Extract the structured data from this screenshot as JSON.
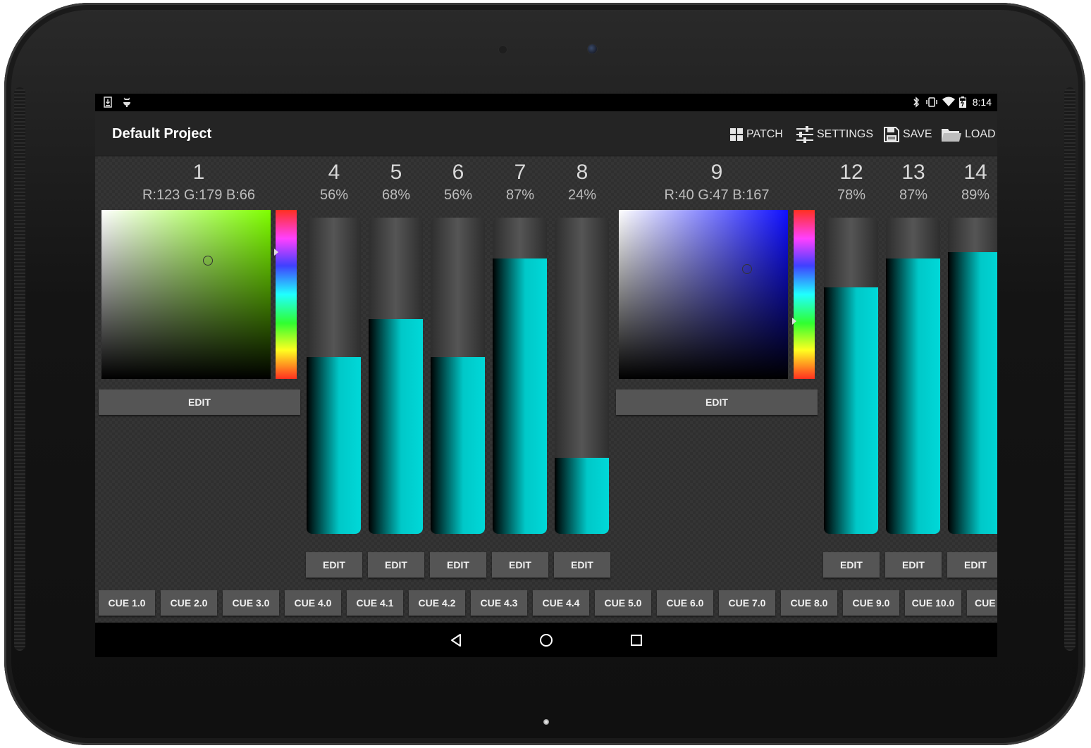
{
  "app_title": "Default Project",
  "status_bar": {
    "time": "8:14",
    "left_icons": [
      "download-icon",
      "android-debug-icon"
    ],
    "right_icons": [
      "bluetooth-icon",
      "vibrate-icon",
      "wifi-icon",
      "battery-icon"
    ]
  },
  "toolbar": {
    "patch": "PATCH",
    "settings": "SETTINGS",
    "save": "SAVE",
    "load": "LOAD"
  },
  "color_channels": [
    {
      "number": "1",
      "value": "R:123 G:179 B:66",
      "hue_color": "#7fff00",
      "edit": "EDIT",
      "saturation": 0.63,
      "brightness": 0.7,
      "hue_level": 0.25
    },
    {
      "number": "9",
      "value": "R:40 G:47 B:167",
      "hue_color": "#1010ff",
      "edit": "EDIT",
      "saturation": 0.76,
      "brightness": 0.65,
      "hue_level": 0.66
    }
  ],
  "fader_channels": [
    {
      "number": "4",
      "value": "56%",
      "level": 0.56,
      "edit": "EDIT"
    },
    {
      "number": "5",
      "value": "68%",
      "level": 0.68,
      "edit": "EDIT"
    },
    {
      "number": "6",
      "value": "56%",
      "level": 0.56,
      "edit": "EDIT"
    },
    {
      "number": "7",
      "value": "87%",
      "level": 0.87,
      "edit": "EDIT"
    },
    {
      "number": "8",
      "value": "24%",
      "level": 0.24,
      "edit": "EDIT"
    },
    {
      "number": "12",
      "value": "78%",
      "level": 0.78,
      "edit": "EDIT"
    },
    {
      "number": "13",
      "value": "87%",
      "level": 0.87,
      "edit": "EDIT"
    },
    {
      "number": "14",
      "value": "89%",
      "level": 0.89,
      "edit": "EDIT"
    }
  ],
  "cues": [
    "CUE 1.0",
    "CUE 2.0",
    "CUE 3.0",
    "CUE 4.0",
    "CUE 4.1",
    "CUE 4.2",
    "CUE 4.3",
    "CUE 4.4",
    "CUE 5.0",
    "CUE 6.0",
    "CUE 7.0",
    "CUE 8.0",
    "CUE 9.0",
    "CUE 10.0",
    "CUE"
  ],
  "colors": {
    "fader_fill": "#00c8c8",
    "button_bg": "#555555",
    "action_bar": "#242424"
  }
}
